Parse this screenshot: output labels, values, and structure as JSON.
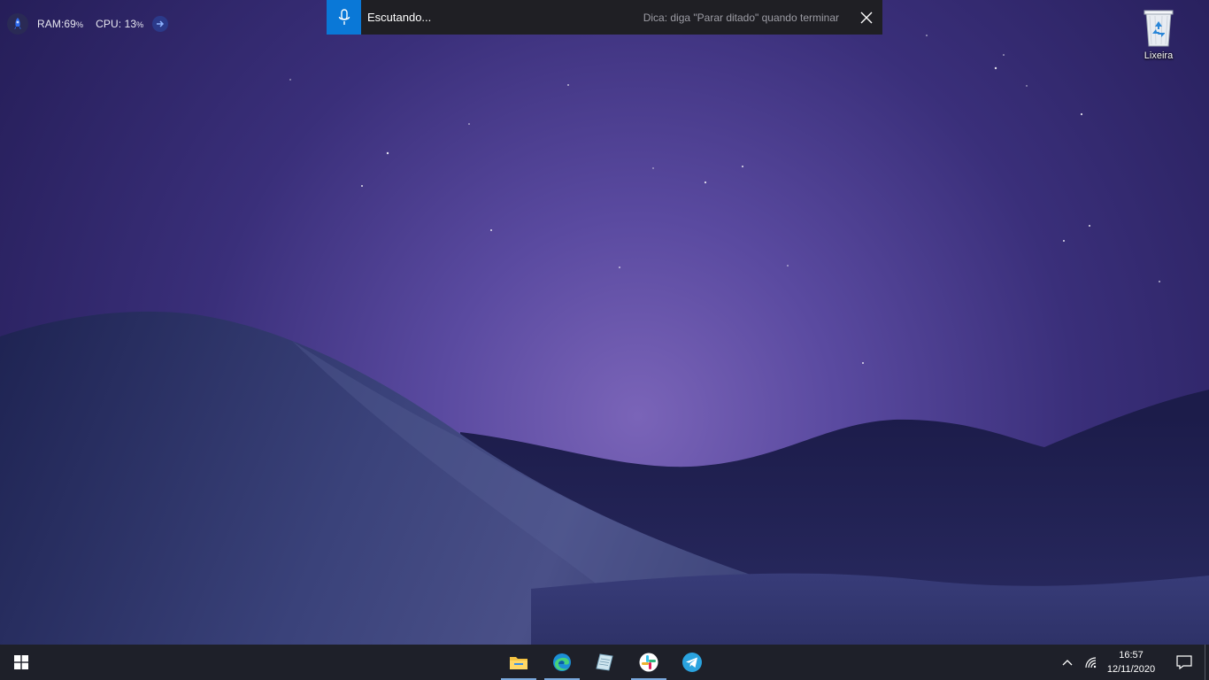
{
  "widget": {
    "ram_label": "RAM:",
    "ram_value": "69",
    "cpu_label": "CPU:",
    "cpu_value": "13",
    "unit": "%"
  },
  "dictation": {
    "status": "Escutando...",
    "hint": "Dica: diga \"Parar ditado\" quando terminar"
  },
  "desktop": {
    "icons": [
      {
        "label": "Lixeira",
        "icon": "recycle-bin-icon"
      }
    ]
  },
  "taskbar": {
    "apps": [
      {
        "name": "file-explorer-icon",
        "running": true
      },
      {
        "name": "edge-icon",
        "running": true
      },
      {
        "name": "notepad-icon",
        "running": false
      },
      {
        "name": "slack-icon",
        "running": true
      },
      {
        "name": "telegram-icon",
        "running": false
      }
    ],
    "time": "16:57",
    "date": "12/11/2020"
  },
  "colors": {
    "dictation_accent": "#0a78d7",
    "taskbar_bg": "#1e2029",
    "sky_top": "#2a2260",
    "sky_horizon": "#7a64b8"
  }
}
